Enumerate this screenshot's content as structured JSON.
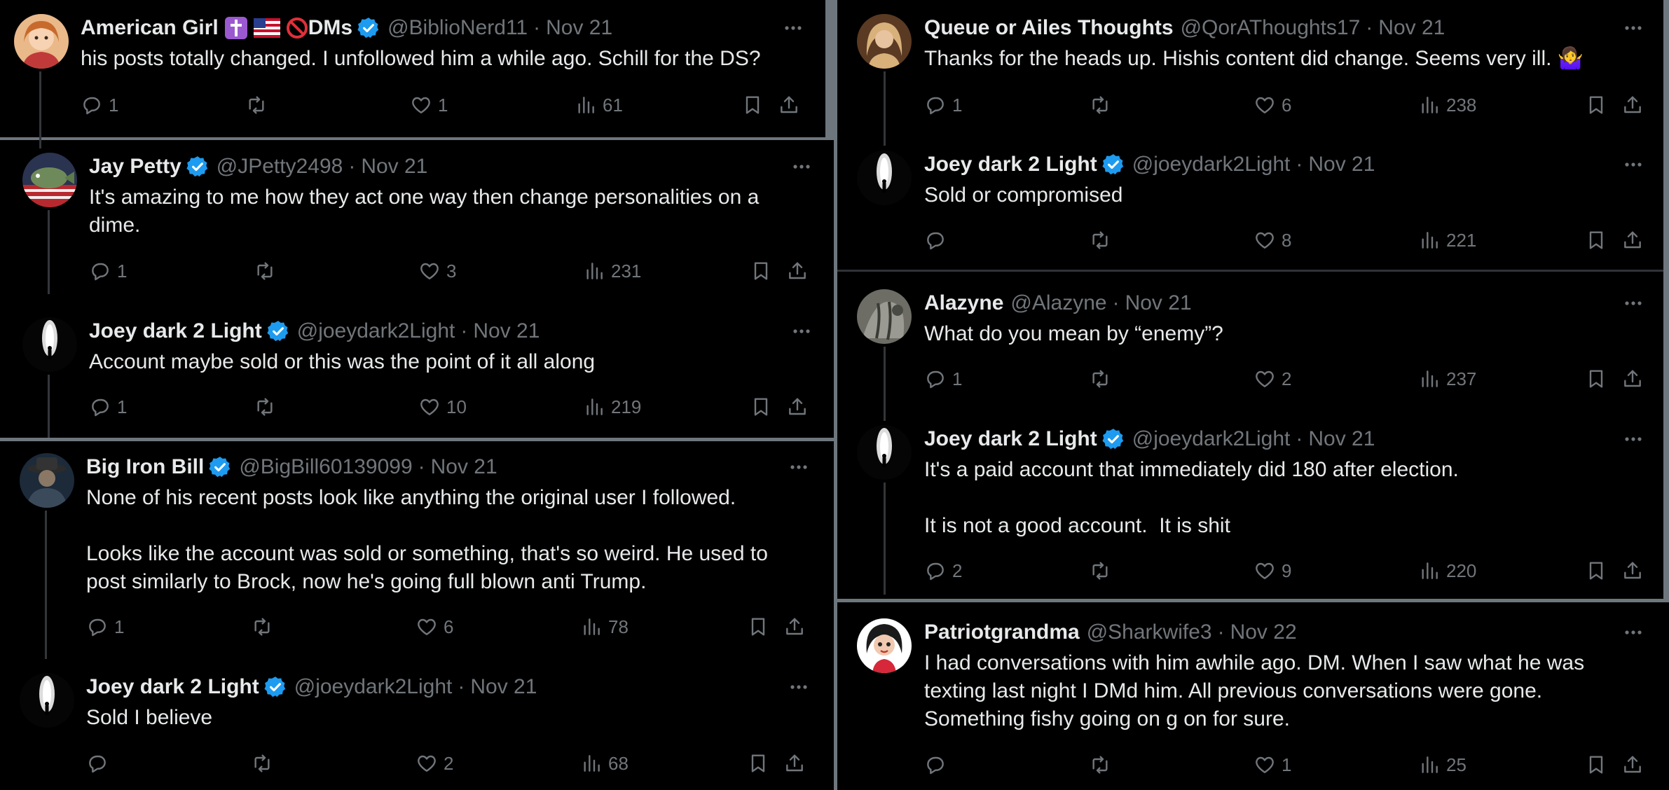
{
  "left_panel": {
    "posts": [
      {
        "name": "American Girl",
        "emojis": [
          "✝️",
          "🇺🇸",
          "🚫"
        ],
        "name_suffix": "DMs",
        "verified": true,
        "handle": "@BiblioNerd11",
        "date": "Nov 21",
        "text": "his posts totally changed. I unfollowed him a while ago. Schill for the DS?",
        "replies": "1",
        "likes": "1",
        "views": "61"
      },
      {
        "name": "Jay Petty",
        "verified": true,
        "handle": "@JPetty2498",
        "date": "Nov 21",
        "text": "It's amazing to me how they act one way then change personalities on a\ndime.",
        "replies": "1",
        "likes": "3",
        "views": "231"
      },
      {
        "name": "Joey dark 2 Light",
        "verified": true,
        "handle": "@joeydark2Light",
        "date": "Nov 21",
        "text": "Account maybe sold or this was the point of it all along",
        "replies": "1",
        "likes": "10",
        "views": "219"
      },
      {
        "name": "Big Iron Bill",
        "verified": true,
        "handle": "@BigBill60139099",
        "date": "Nov 21",
        "text": "None of his recent posts look like anything the original user I followed.\n\nLooks like the account was sold or something, that's so weird. He used to\npost similarly to Brock, now he's going full blown anti Trump.",
        "replies": "1",
        "likes": "6",
        "views": "78"
      },
      {
        "name": "Joey dark 2 Light",
        "verified": true,
        "handle": "@joeydark2Light",
        "date": "Nov 21",
        "text": "Sold I believe",
        "replies": "",
        "likes": "2",
        "views": "68"
      }
    ]
  },
  "right_panel": {
    "posts": [
      {
        "name": "Queue or Ailes Thoughts",
        "verified": false,
        "handle": "@QorAThoughts17",
        "date": "Nov 21",
        "text": "Thanks for the heads up. Hishis content did change. Seems very ill. 🤷‍♀️",
        "replies": "1",
        "likes": "6",
        "views": "238"
      },
      {
        "name": "Joey dark 2 Light",
        "verified": true,
        "handle": "@joeydark2Light",
        "date": "Nov 21",
        "text": "Sold or compromised",
        "replies": "",
        "likes": "8",
        "views": "221"
      },
      {
        "name": "Alazyne",
        "verified": false,
        "handle": "@Alazyne",
        "date": "Nov 21",
        "text": "What do you mean by “enemy”?",
        "replies": "1",
        "likes": "2",
        "views": "237"
      },
      {
        "name": "Joey dark 2 Light",
        "verified": true,
        "handle": "@joeydark2Light",
        "date": "Nov 21",
        "text": "It's a paid account that immediately did 180 after election.\n\nIt is not a good account.  It is shit",
        "replies": "2",
        "likes": "9",
        "views": "220"
      },
      {
        "name": "Patriotgrandma",
        "verified": false,
        "handle": "@Sharkwife3",
        "date": "Nov 22",
        "text": "I had conversations with him awhile ago. DM. When I saw what he was\ntexting last night I DMd him. All previous conversations were gone.\nSomething fishy going on g on for sure.",
        "replies": "",
        "likes": "1",
        "views": "25"
      }
    ]
  },
  "icons": {
    "reply": "reply-icon",
    "repost": "repost-icon",
    "like": "heart-icon",
    "views": "views-icon",
    "bookmark": "bookmark-icon",
    "share": "share-icon",
    "more": "more-icon",
    "verified": "verified-badge-icon"
  },
  "colors": {
    "background": "#000000",
    "text": "#e7e9ea",
    "muted": "#71767b",
    "verified": "#1d9bf0",
    "separator": "#6e767d"
  }
}
